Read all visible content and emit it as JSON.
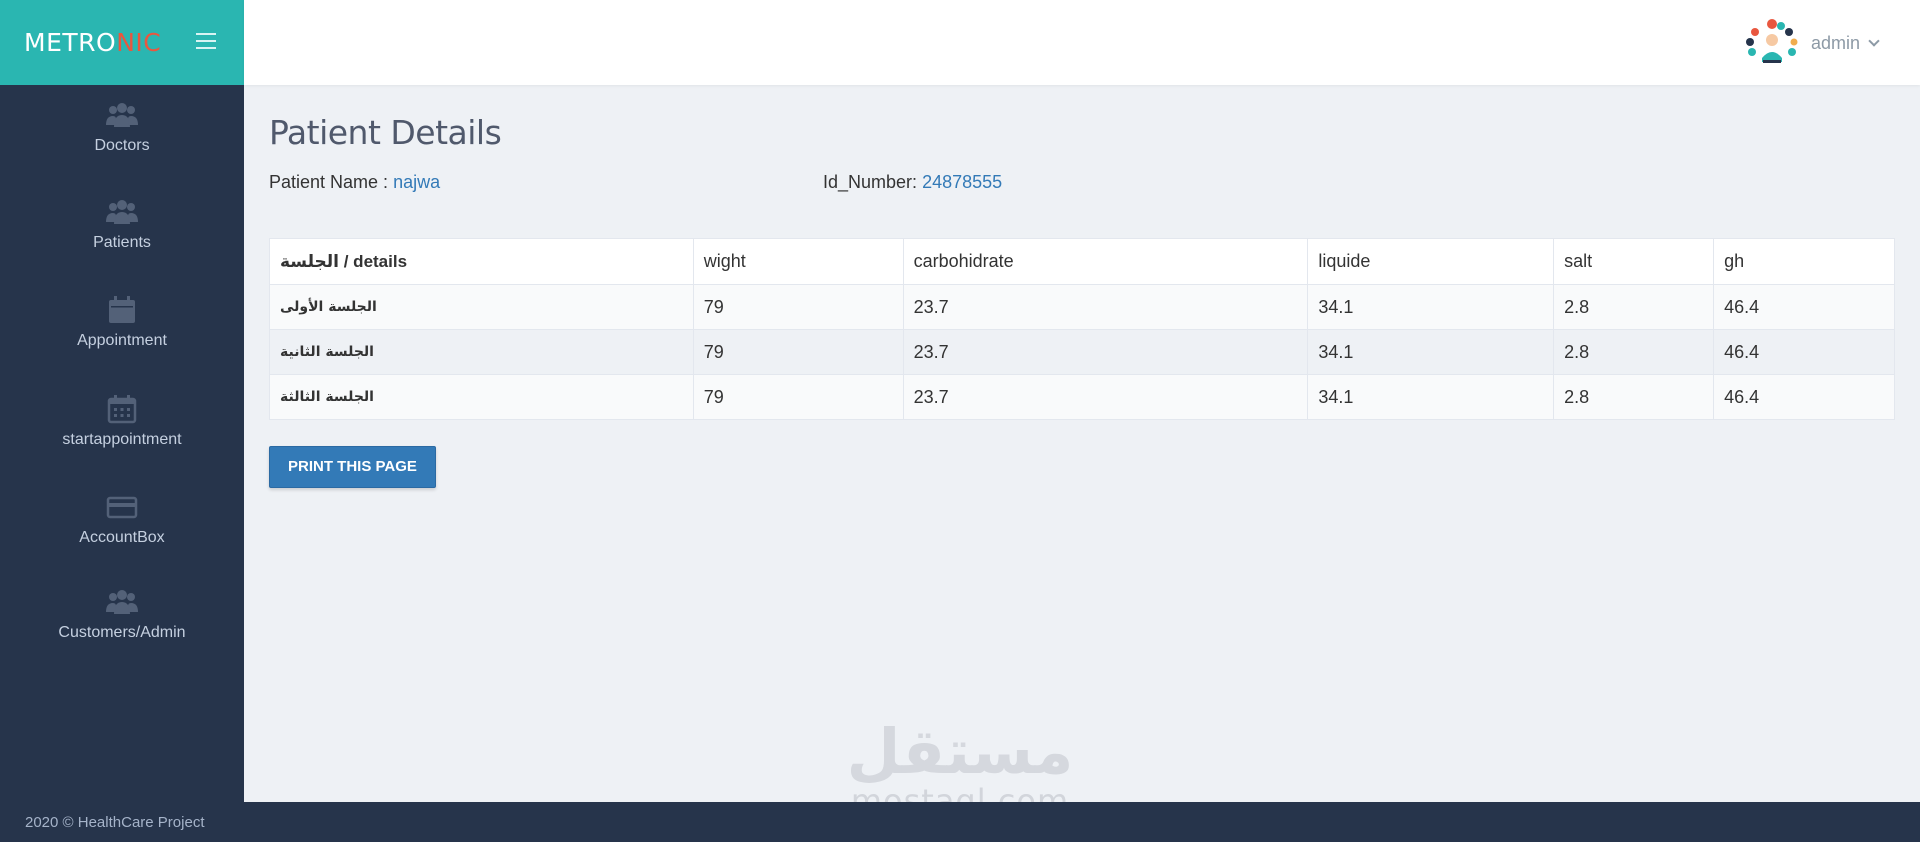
{
  "brand": {
    "logo_main": "METRO",
    "logo_accent": "NIC"
  },
  "header": {
    "username": "admin"
  },
  "sidebar": {
    "items": [
      {
        "label": "Doctors",
        "icon": "users-icon"
      },
      {
        "label": "Patients",
        "icon": "users-icon"
      },
      {
        "label": "Appointment",
        "icon": "calendar-icon"
      },
      {
        "label": "startappointment",
        "icon": "calendar-grid-icon"
      },
      {
        "label": "AccountBox",
        "icon": "credit-card-icon"
      },
      {
        "label": "Customers/Admin",
        "icon": "users-icon"
      }
    ]
  },
  "page": {
    "title": "Patient Details",
    "patient_name_label": "Patient Name :",
    "patient_name_value": "najwa",
    "id_label": "Id_Number:",
    "id_value": "24878555"
  },
  "table": {
    "headers": [
      "الجلسة / details",
      "wight",
      "carbohidrate",
      "liquide",
      "salt",
      "gh"
    ],
    "rows": [
      [
        "الجلسة الأولى",
        "79",
        "23.7",
        "34.1",
        "2.8",
        "46.4"
      ],
      [
        "الجلسة الثانية",
        "79",
        "23.7",
        "34.1",
        "2.8",
        "46.4"
      ],
      [
        "الجلسة الثالثة",
        "79",
        "23.7",
        "34.1",
        "2.8",
        "46.4"
      ]
    ]
  },
  "actions": {
    "print_label": "PRINT THIS PAGE"
  },
  "footer": {
    "text": "2020 © HealthCare Project"
  },
  "watermark": {
    "arabic": "مستقل",
    "latin": "mostaql.com"
  },
  "colors": {
    "brand": "#2ab6b1",
    "sidebar": "#26344b",
    "accent": "#e9573f",
    "link": "#337ab7",
    "button": "#337ab7"
  }
}
